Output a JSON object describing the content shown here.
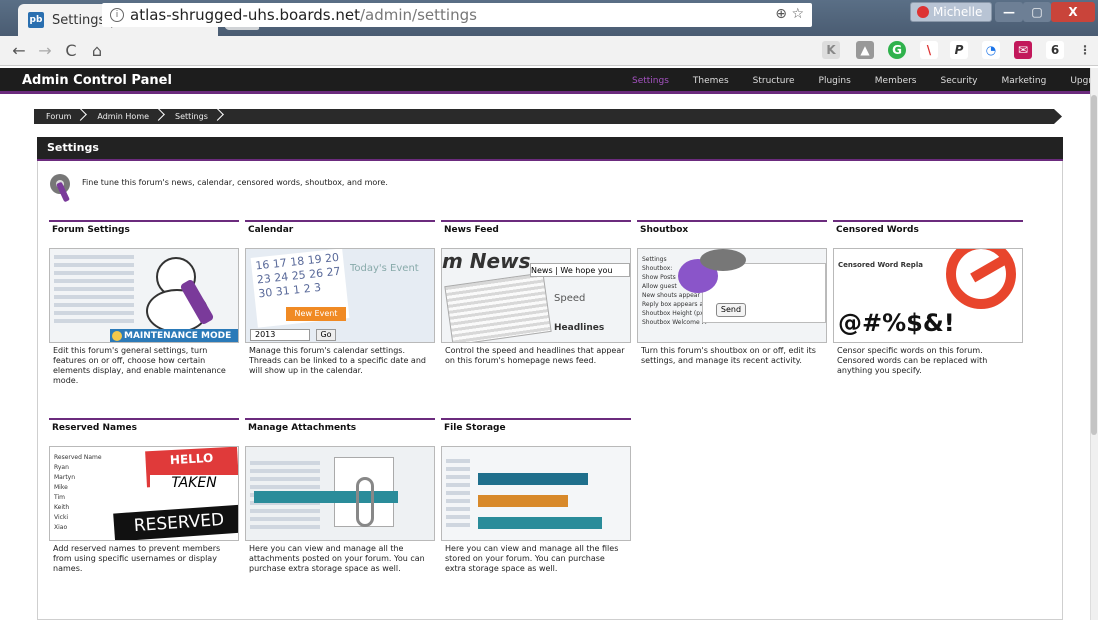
{
  "browser": {
    "tab_title": "Settings | Forum",
    "tab_close": "×",
    "favicon_text": "pb",
    "user_name": "Michelle",
    "url_host": "atlas-shrugged-uhs.boards.net",
    "url_path": "/admin/settings",
    "nav": {
      "back": "←",
      "forward": "→",
      "reload": "C",
      "home": "⌂"
    },
    "omni_icons": "⊕ ☆"
  },
  "admin": {
    "title": "Admin Control Panel",
    "nav": [
      "Settings",
      "Themes",
      "Structure",
      "Plugins",
      "Members",
      "Security",
      "Marketing",
      "Upgrades"
    ],
    "active_nav": "Settings"
  },
  "breadcrumb": [
    "Forum",
    "Admin Home",
    "Settings"
  ],
  "panel": {
    "title": "Settings",
    "intro": "Fine tune this forum's news, calendar, censored words, shoutbox, and more."
  },
  "cards": [
    {
      "title": "Forum Settings",
      "desc": "Edit this forum's general settings, turn features on or off, choose how certain elements display, and enable maintenance mode.",
      "badge": "MAINTENANCE MODE"
    },
    {
      "title": "Calendar",
      "desc": "Manage this forum's calendar settings. Threads can be linked to a specific date and will show up in the calendar.",
      "cal_dates": "16 17 18 19 20\n23 24 25 26 27\n30 31 1 2 3",
      "today": "Today's Event",
      "event": "New Event",
      "year": "2013",
      "go": "Go"
    },
    {
      "title": "News Feed",
      "desc": "Control the speed and headlines that appear on this forum's homepage news feed.",
      "headline": "m News",
      "news_label": "News | We hope you",
      "speed": "Speed",
      "headlines": "Headlines"
    },
    {
      "title": "Shoutbox",
      "desc": "Turn this forum's shoutbox on or off, edit its settings, and manage its recent activity.",
      "send": "Send",
      "list": "Settings\nShoutbox:\nShow Posts\nAllow guest\nNew shouts appear a\nReply box appears at\nShoutbox Height (px)\nShoutbox Welcome M"
    },
    {
      "title": "Censored Words",
      "desc": "Censor specific words on this forum. Censored words can be replaced with anything you specify.",
      "symbols": "@#%$&!",
      "head": "Censored Word   Repla"
    },
    {
      "title": "Reserved Names",
      "desc": "Add reserved names to prevent members from using specific usernames or display names.",
      "hello": "HELLO",
      "taken": "TAKEN",
      "reserved": "RESERVED",
      "list": "Reserved Name\nRyan\nMartyn\nMike\nTim\nKeith\nVicki\nXiao"
    },
    {
      "title": "Manage Attachments",
      "desc": "Here you can view and manage all the attachments posted on your forum. You can purchase extra storage space as well."
    },
    {
      "title": "File Storage",
      "desc": "Here you can view and manage all the files stored on your forum. You can purchase extra storage space as well."
    }
  ],
  "colors": {
    "accent": "#6b2b7d",
    "admin_bar": "#1d1d1d",
    "active_nav": "#a452c0"
  }
}
